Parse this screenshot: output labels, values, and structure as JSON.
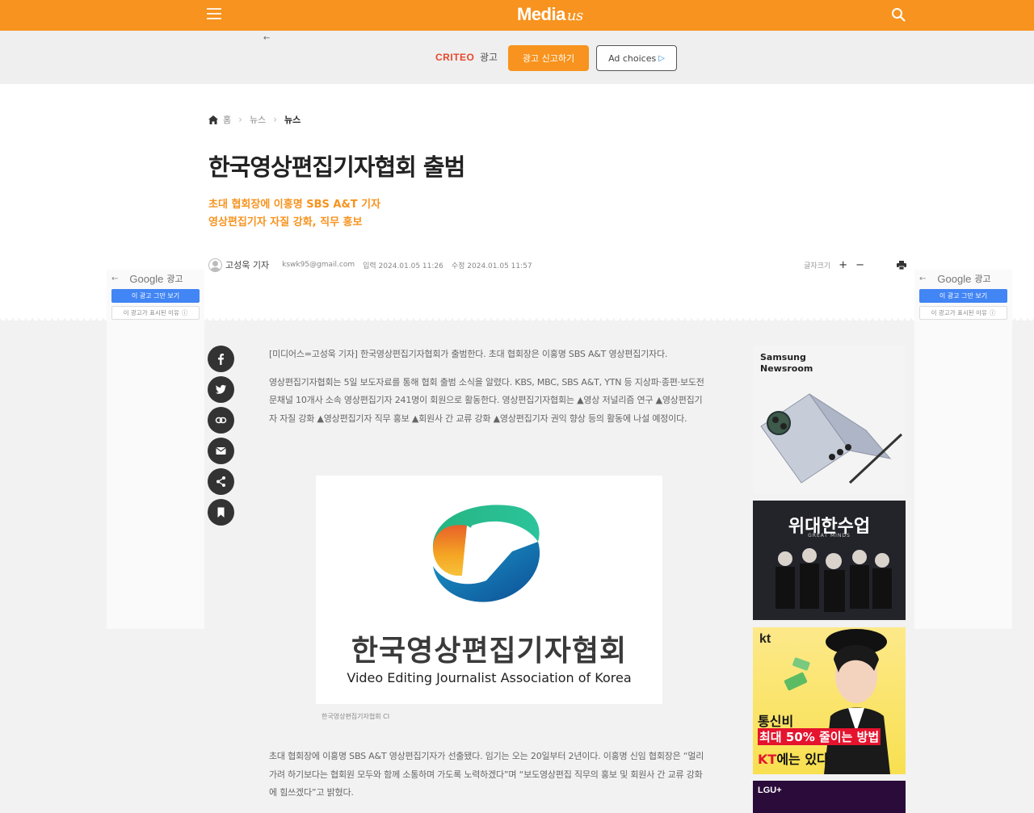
{
  "topbar": {
    "logo_main": "Media",
    "logo_script": "us"
  },
  "ad_strip": {
    "back_arrow": "←",
    "criteo_brand": "CRITEO",
    "criteo_label": "광고",
    "report_button": "광고 신고하기",
    "adchoices_button": "Ad choices"
  },
  "breadcrumb": {
    "home": "홈",
    "section": "뉴스",
    "current": "뉴스"
  },
  "article": {
    "title": "한국영상편집기자협회 출범",
    "subtitle_line1": "초대 협회장에 이홍명 SBS A&T 기자",
    "subtitle_line2": "영상편집기자 자질 강화, 직무 홍보",
    "reporter": "고성욱 기자",
    "email": "kswk95@gmail.com",
    "published": "입력 2024.01.05 11:26",
    "modified": "수정 2024.01.05 11:57",
    "font_size_label": "글자크기",
    "font_plus": "+",
    "font_minus": "−",
    "paragraph1": "[미디어스=고성욱 기자] 한국영상편집기자협회가 출범한다. 초대 협회장은 이홍명 SBS A&T 영상편집기자다.",
    "paragraph2": "영상편집기자협회는 5일 보도자료를 통해 협회 출범 소식을 알렸다. KBS, MBC, SBS A&T, YTN 등 지상파·종편·보도전문채널 10개사 소속 영상편집기자 241명이 회원으로 활동한다. 영상편집기자협회는 ▲영상 저널리즘 연구 ▲영상편집기자 자질 강화 ▲영상편집기자 직무 홍보 ▲회원사 간 교류 강화 ▲영상편집기자 권익 향상 등의 활동에 나설 예정이다.",
    "figure_korean": "한국영상편집기자협회",
    "figure_english": "Video Editing Journalist Association of Korea",
    "caption": "한국영상편집기자협회 CI",
    "paragraph3": "초대 협회장에 이홍명 SBS A&T 영상편집기자가 선출됐다. 임기는 오는 20일부터 2년이다. 이홍명 신임 협회장은 “멀리 가려 하기보다는 협회원 모두와 함께 소통하며 가도록 노력하겠다”며 “보도영상편집 직무의 홍보 및 회원사 간 교류 강화에 힘쓰겠다”고 밝혔다."
  },
  "google_ad": {
    "back_arrow": "←",
    "google_word": "Google",
    "ad_label": "광고",
    "stop_button": "이 광고 그만 보기",
    "why_button": "이 광고가 표시된 이유",
    "info_icon": "ⓘ"
  },
  "right_ads": {
    "samsung_line1": "Samsung",
    "samsung_line2": "Newsroom",
    "class_title": "위대한수업",
    "class_sub": "GREAT MINDS",
    "kt_logo": "kt",
    "kt_line1": "통신비",
    "kt_line2": "최대 50% 줄이는 방법",
    "kt_line3_a": "KT",
    "kt_line3_b": "에는 있다",
    "lgu_logo": "LGU+"
  },
  "colors": {
    "brand_orange": "#f7931e",
    "criteo_red": "#e8472c",
    "google_blue": "#4285f4",
    "kt_red": "#e5132e"
  }
}
